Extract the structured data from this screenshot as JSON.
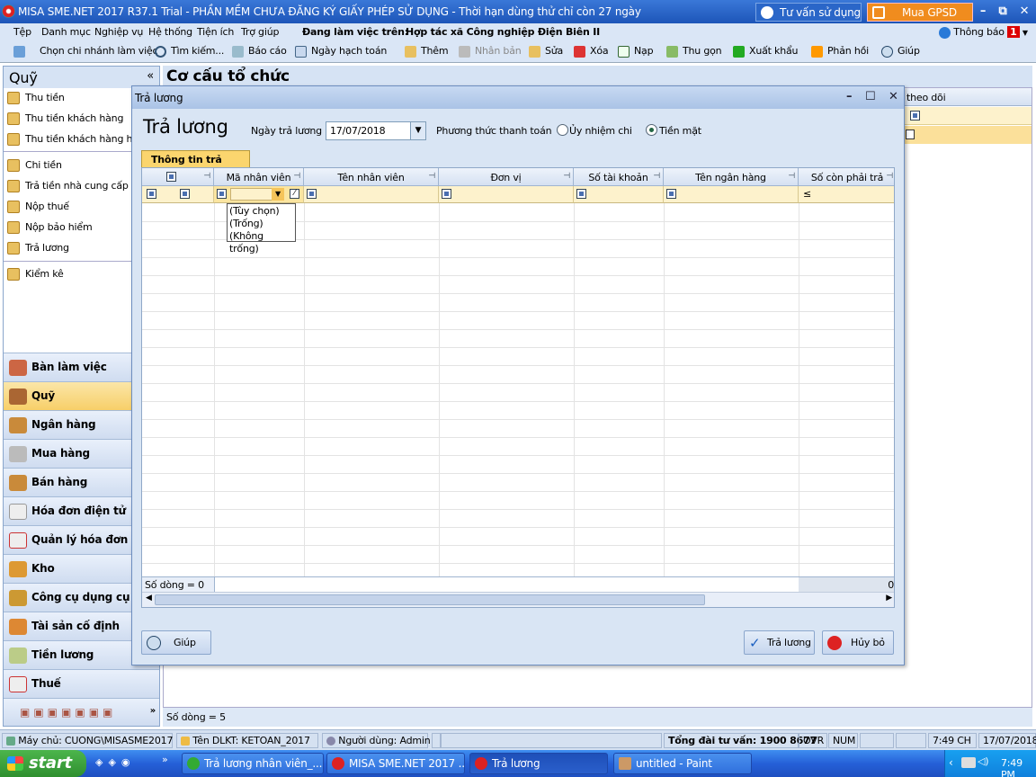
{
  "titlebar": {
    "title": "MISA SME.NET 2017 R37.1 Trial - PHẦN MỀM CHƯA ĐĂNG KÝ GIẤY PHÉP SỬ DỤNG - Thời hạn dùng thử chỉ còn 27 ngày",
    "consult": "Tư vấn sử dụng",
    "buy": "Mua GPSD"
  },
  "menu": {
    "items": [
      "Tệp",
      "Danh mục",
      "Nghiệp vụ",
      "Hệ thống",
      "Tiện ích",
      "Trợ giúp"
    ],
    "workspace_label": "Đang làm việc trên:",
    "workspace": "Hợp tác xã Công nghiệp Điện Biên II",
    "notify": "Thông báo",
    "notify_count": "1"
  },
  "toolbar": {
    "items": [
      "Chọn chi nhánh làm việc",
      "Tìm kiếm...",
      "Báo cáo",
      "Ngày hạch toán",
      "Thêm",
      "Nhân bản",
      "Sửa",
      "Xóa",
      "Nạp",
      "Thu gọn",
      "Xuất khẩu",
      "Phản hồi",
      "Giúp"
    ]
  },
  "leftpanel": {
    "title": "Quỹ",
    "items": [
      "Thu tiền",
      "Thu tiền khách hàng",
      "Thu tiền khách hàng hà",
      "Chi tiền",
      "Trả tiền nhà cung cấp",
      "Nộp thuế",
      "Nộp bảo hiểm",
      "Trả lương",
      "Kiểm kê"
    ],
    "modules": [
      "Bàn làm việc",
      "Quỹ",
      "Ngân hàng",
      "Mua hàng",
      "Bán hàng",
      "Hóa đơn điện tử",
      "Quản lý hóa đơn",
      "Kho",
      "Công cụ dụng cụ",
      "Tài sản cố định",
      "Tiền lương",
      "Thuế"
    ]
  },
  "main": {
    "title": "Cơ cấu tổ chức",
    "col_partial": "theo dõi",
    "footer": "Số dòng = 5"
  },
  "dialog": {
    "title": "Trả lương",
    "heading": "Trả lương",
    "date_label": "Ngày trả lương",
    "date_value": "17/07/2018",
    "method_label": "Phương thức thanh toán",
    "method_options": [
      "Ủy nhiệm chi",
      "Tiền mặt"
    ],
    "tab": "Thông tin trả lương",
    "columns": [
      "Mã nhân viên",
      "Tên nhân viên",
      "Đơn vị",
      "Số tài khoản",
      "Tên ngân hàng",
      "Số còn phải trả"
    ],
    "filter_options": [
      "(Tùy chọn)",
      "(Trống)",
      "(Không trống)"
    ],
    "filter_op": "≤",
    "row_count": "Số dòng = 0",
    "total": "0",
    "help": "Giúp",
    "pay": "Trả lương",
    "cancel": "Hủy bỏ"
  },
  "statusbar": {
    "server": "Máy chủ: CUONG\\MISASME2017",
    "db": "Tên DLKT: KETOAN_2017",
    "user": "Người dùng: Admin",
    "hotline": "Tổng đài tư vấn: 1900 8677",
    "ovr": "OVR",
    "num": "NUM",
    "time": "7:49 CH",
    "date": "17/07/2018"
  },
  "taskbar": {
    "start": "start",
    "tasks": [
      "Trả lương nhân viên_...",
      "MISA SME.NET 2017 ...",
      "Trả lương",
      "untitled - Paint"
    ],
    "clock": "7:49 PM"
  }
}
